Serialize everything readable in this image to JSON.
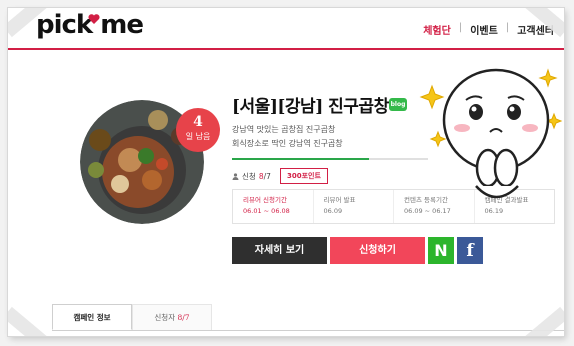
{
  "brand": {
    "logo_text": "pick me"
  },
  "nav": {
    "items": [
      "체험단",
      "이벤트",
      "고객센터"
    ],
    "separator": "|",
    "active_color": "#d21f45"
  },
  "campaign": {
    "badge_number": "4",
    "badge_text": "일 남음",
    "title": "[서울][강남] 진구곱창",
    "blog_icon": "blog",
    "description": [
      "강남역 맛있는 곱창집 진구곱창",
      "회식장소로 딱인 강남역 진구곱창"
    ],
    "progress_fraction": 0.7,
    "applicants_label": "신청",
    "applicants_count": "8",
    "applicants_total": "/7",
    "points": "300포인트",
    "schedule": [
      {
        "label": "리뷰어 신청기간",
        "date": "06.01 ~ 06.08",
        "active": true
      },
      {
        "label": "리뷰어 발표",
        "date": "06.09",
        "active": false
      },
      {
        "label": "컨텐츠 등록기간",
        "date": "06.09 ~ 06.17",
        "active": false
      },
      {
        "label": "캠페인 결과발표",
        "date": "06.19",
        "active": false
      }
    ],
    "buttons": {
      "detail": "자세히 보기",
      "apply": "신청하기",
      "naver": "N",
      "facebook": "f"
    }
  },
  "tabs": {
    "info": "캠페인 정보",
    "applicants_label": "신청자",
    "applicants_value": "8/7"
  },
  "colors": {
    "accent": "#d21f45",
    "apply_button": "#f2465a",
    "naver": "#2cb52c",
    "facebook": "#3b5998",
    "progress": "#2aa64a"
  }
}
